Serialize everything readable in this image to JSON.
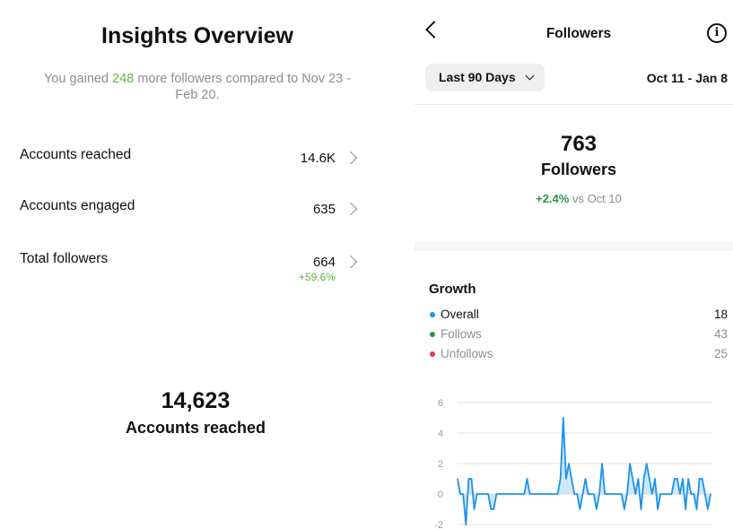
{
  "overview": {
    "title": "Insights Overview",
    "subtitle_pre": "You gained ",
    "subtitle_highlight": "248",
    "subtitle_post": " more followers compared to Nov 23 - Feb 20.",
    "metrics": [
      {
        "label": "Accounts reached",
        "value": "14.6K",
        "delta": ""
      },
      {
        "label": "Accounts engaged",
        "value": "635",
        "delta": ""
      },
      {
        "label": "Total followers",
        "value": "664",
        "delta": "+59.6%"
      }
    ],
    "big_number": "14,623",
    "big_label": "Accounts reached"
  },
  "followers": {
    "header_title": "Followers",
    "info_glyph": "i",
    "range_label": "Last 90 Days",
    "date_range": "Oct 11 - Jan 8",
    "count": "763",
    "count_label": "Followers",
    "change_pct": "+2.4%",
    "change_text": " vs Oct 10",
    "growth_title": "Growth",
    "legend": [
      {
        "name": "Overall",
        "value": "18",
        "color": "#1e93e8"
      },
      {
        "name": "Follows",
        "value": "43",
        "color": "#2f9447"
      },
      {
        "name": "Unfollows",
        "value": "25",
        "color": "#e33a4e"
      }
    ]
  },
  "chart_data": {
    "type": "area",
    "title": "",
    "xlabel": "",
    "ylabel": "",
    "yticks": [
      "6",
      "4",
      "2",
      "0",
      "-2"
    ],
    "ylim": [
      -2,
      6
    ],
    "grid": true,
    "series": [
      {
        "name": "Overall",
        "color": "#1e93e8",
        "values": [
          1,
          0,
          0,
          -2,
          1,
          1,
          -1,
          0,
          0,
          0,
          0,
          0,
          -1,
          -1,
          0,
          0,
          0,
          0,
          0,
          0,
          0,
          0,
          0,
          0,
          0,
          1,
          0,
          0,
          0,
          0,
          0,
          0,
          0,
          0,
          0,
          0,
          0,
          1,
          5,
          1,
          2,
          1,
          0,
          0,
          -1,
          0,
          1,
          0,
          0,
          0,
          -1,
          0,
          2,
          0,
          0,
          0,
          0,
          0,
          0,
          0,
          -1,
          0,
          2,
          1,
          0,
          1,
          -1,
          1,
          2,
          1,
          0,
          1,
          -1,
          0,
          0,
          0,
          0,
          0,
          1,
          1,
          0,
          1,
          -1,
          1,
          0,
          0,
          -1,
          1,
          1,
          0,
          -1,
          0
        ]
      }
    ]
  }
}
